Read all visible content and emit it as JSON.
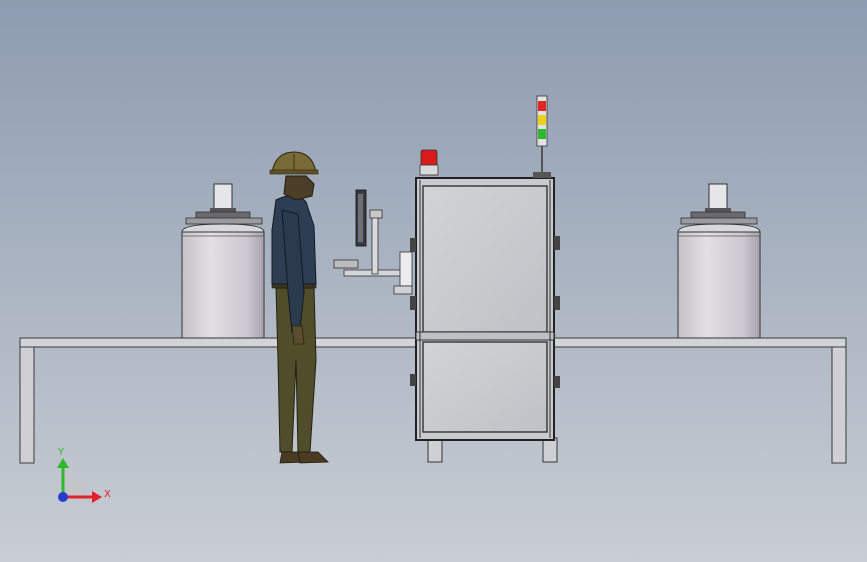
{
  "viewport": {
    "background_top": "#8d9cb0",
    "background_bottom": "#c9cdd4"
  },
  "triad": {
    "x_label": "X",
    "y_label": "Y",
    "x_color": "#e0202a",
    "y_color": "#2eb82e",
    "z_color": "#2a3ad0"
  },
  "machine": {
    "beacon_color": "#d81c1c",
    "stack_light": [
      "#e0261f",
      "#e8d21a",
      "#2eb82e"
    ]
  },
  "icons": {
    "left_tank": "tank-icon",
    "right_tank": "tank-icon",
    "operator": "worker-icon",
    "monitor": "monitor-icon",
    "beacon": "beacon-icon",
    "stack_light": "stack-light-icon"
  }
}
